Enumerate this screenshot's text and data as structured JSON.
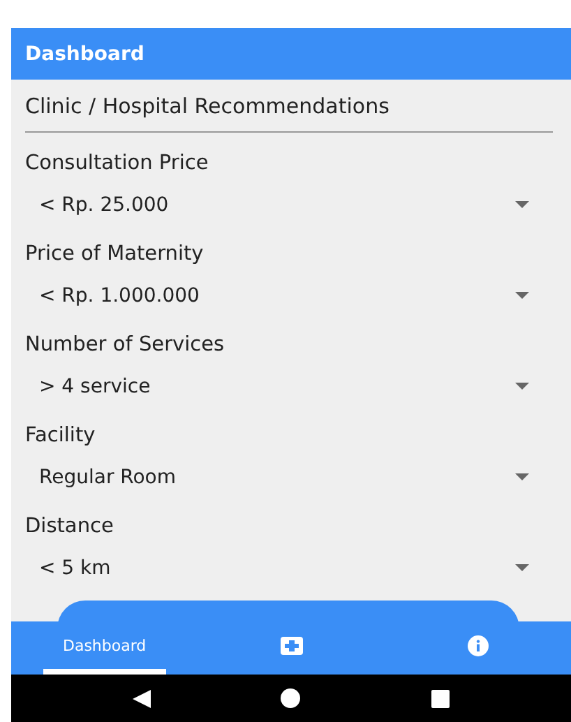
{
  "app_bar": {
    "title": "Dashboard"
  },
  "page_title": "Clinic / Hospital Recommendations",
  "filters": [
    {
      "label": "Consultation Price",
      "value": "< Rp. 25.000"
    },
    {
      "label": "Price of Maternity",
      "value": "< Rp. 1.000.000"
    },
    {
      "label": "Number of Services",
      "value": "> 4 service"
    },
    {
      "label": "Facility",
      "value": "Regular Room"
    },
    {
      "label": "Distance",
      "value": "< 5 km"
    }
  ],
  "bottom_nav": [
    {
      "kind": "text",
      "label": "Dashboard",
      "selected": true
    },
    {
      "kind": "plus",
      "selected": false
    },
    {
      "kind": "info",
      "selected": false
    }
  ]
}
